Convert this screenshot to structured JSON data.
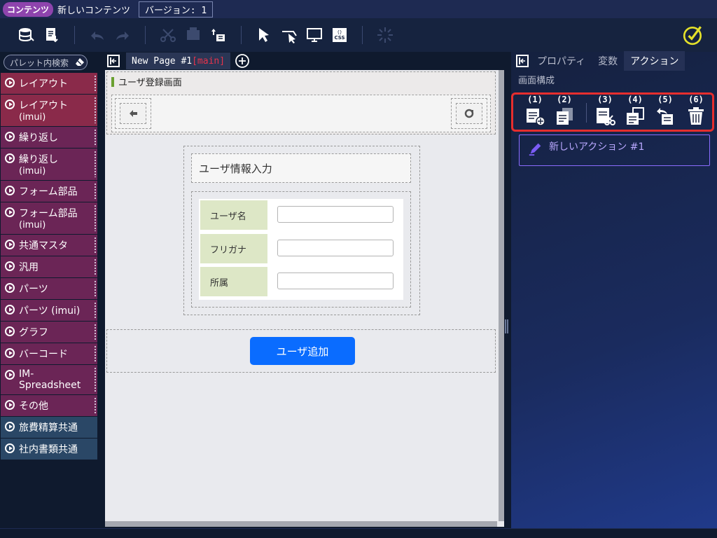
{
  "header": {
    "brand": "コンテンツ",
    "title": "新しいコンテンツ",
    "version": "バージョン: 1"
  },
  "toolbar": {
    "icons": [
      "database-icon",
      "export-icon",
      "undo-icon",
      "redo-icon",
      "cut-icon",
      "component-icon",
      "swap-icon",
      "select-icon",
      "cursor-area-icon",
      "monitor-icon",
      "css-icon",
      "spinner-icon",
      "edit-check-icon"
    ]
  },
  "palette": {
    "search_placeholder": "パレット内検索",
    "items": [
      {
        "label": "レイアウト",
        "sub": "",
        "color": "red"
      },
      {
        "label": "レイアウト",
        "sub": "(imui)",
        "color": "red"
      },
      {
        "label": "繰り返し",
        "sub": "",
        "color": "mag"
      },
      {
        "label": "繰り返し",
        "sub": "(imui)",
        "color": "mag"
      },
      {
        "label": "フォーム部品",
        "sub": "",
        "color": "mag"
      },
      {
        "label": "フォーム部品",
        "sub": "(imui)",
        "color": "mag"
      },
      {
        "label": "共通マスタ",
        "sub": "",
        "color": "mag"
      },
      {
        "label": "汎用",
        "sub": "",
        "color": "mag"
      },
      {
        "label": "パーツ",
        "sub": "",
        "color": "mag"
      },
      {
        "label": "パーツ (imui)",
        "sub": "",
        "color": "mag"
      },
      {
        "label": "グラフ",
        "sub": "",
        "color": "mag"
      },
      {
        "label": "バーコード",
        "sub": "",
        "color": "mag"
      },
      {
        "label": "IM-Spreadsheet",
        "sub": "",
        "color": "mag"
      },
      {
        "label": "その他",
        "sub": "",
        "color": "mag"
      },
      {
        "label": "旅費精算共通",
        "sub": "",
        "color": "blue"
      },
      {
        "label": "社内書類共通",
        "sub": "",
        "color": "blue"
      }
    ]
  },
  "page_tab": {
    "name": "New Page #1",
    "suffix": "[main]"
  },
  "canvas": {
    "header_title": "ユーザ登録画面",
    "form_heading": "ユーザ情報入力",
    "fields": [
      {
        "label": "ユーザ名",
        "value": ""
      },
      {
        "label": "フリガナ",
        "value": ""
      },
      {
        "label": "所属",
        "value": ""
      }
    ],
    "add_button": "ユーザ追加"
  },
  "right_panel": {
    "tabs": [
      "プロパティ",
      "変数",
      "アクション"
    ],
    "active_tab": "アクション",
    "section": "画面構成",
    "action_buttons": [
      "(1)",
      "(2)",
      "(3)",
      "(4)",
      "(5)",
      "(6)"
    ],
    "action_item": "新しいアクション #1"
  },
  "colors": {
    "accent_red": "#e62e2e",
    "button_blue": "#0a6cff",
    "label_green": "#dde7c6",
    "brand_purple": "#8e44ad"
  }
}
